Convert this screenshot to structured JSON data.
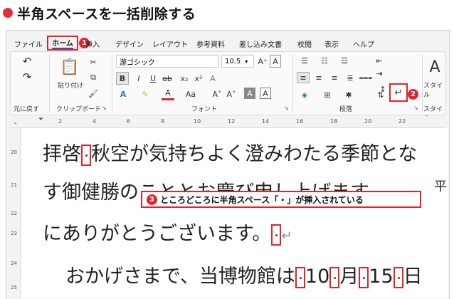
{
  "title": "半角スペースを一括削除する",
  "tabs": [
    "ファイル",
    "ホーム",
    "挿入",
    "デザイン",
    "レイアウト",
    "参考資料",
    "差し込み文書",
    "校閲",
    "表示",
    "ヘルプ"
  ],
  "active_tab_index": 1,
  "ribbon": {
    "undo_label": "元に戻す",
    "paste_label": "貼り付け",
    "clipboard_label": "クリップボード",
    "font_name": "游ゴシック",
    "font_size": "10.5",
    "font_group_label": "フォント",
    "paragraph_group_label": "段落",
    "style_label": "スタイル",
    "style_group_label": "スタイル",
    "aa_label": "Aa"
  },
  "badges": {
    "b1": "1",
    "b2": "2",
    "b3": "3"
  },
  "callout_text": "ところどころに半角スペース「・」が挿入されている",
  "ruler_numbers": [
    "2",
    "4",
    "6",
    "8",
    "10",
    "12",
    "14",
    "16",
    "18",
    "20",
    "22"
  ],
  "vruler_numbers": [
    "20",
    "21",
    "22",
    "23",
    "24",
    "25"
  ],
  "document": {
    "line1_a": "拝啓",
    "line1_b": "秋空が気持ちよく澄みわたる季節と",
    "line1_c": "な",
    "line2": "す御健勝のこととお慶び申し上げます。",
    "line2_tail": "平",
    "line3": "にありがとうございます。",
    "line4_a": "おかげさまで、当博物館は",
    "line4_b": "10",
    "line4_c": "月",
    "line4_d": "15",
    "line4_e": "日"
  },
  "colors": {
    "accent_red": "#e2232b",
    "title_dot": "#e0303e",
    "tab_underline": "#1a5fb4"
  }
}
